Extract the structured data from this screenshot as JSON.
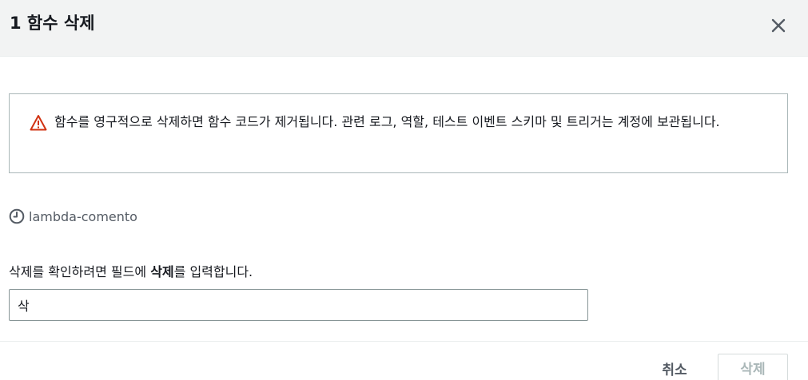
{
  "header": {
    "title": "1 함수 삭제",
    "close_icon": "close-icon"
  },
  "alert": {
    "icon": "warning-icon",
    "icon_color": "#d13212",
    "message": "함수를 영구적으로 삭제하면 함수 코드가 제거됩니다. 관련 로그, 역할, 테스트 이벤트 스키마 및 트리거는 계정에 보관됩니다."
  },
  "function": {
    "icon": "clock-icon",
    "name": "lambda-comento"
  },
  "confirm": {
    "label_prefix": "삭제를 확인하려면 필드에 ",
    "label_keyword": "삭제",
    "label_suffix": "를 입력합니다.",
    "input_value": "삭"
  },
  "footer": {
    "cancel_label": "취소",
    "delete_label": "삭제",
    "delete_disabled": true
  }
}
